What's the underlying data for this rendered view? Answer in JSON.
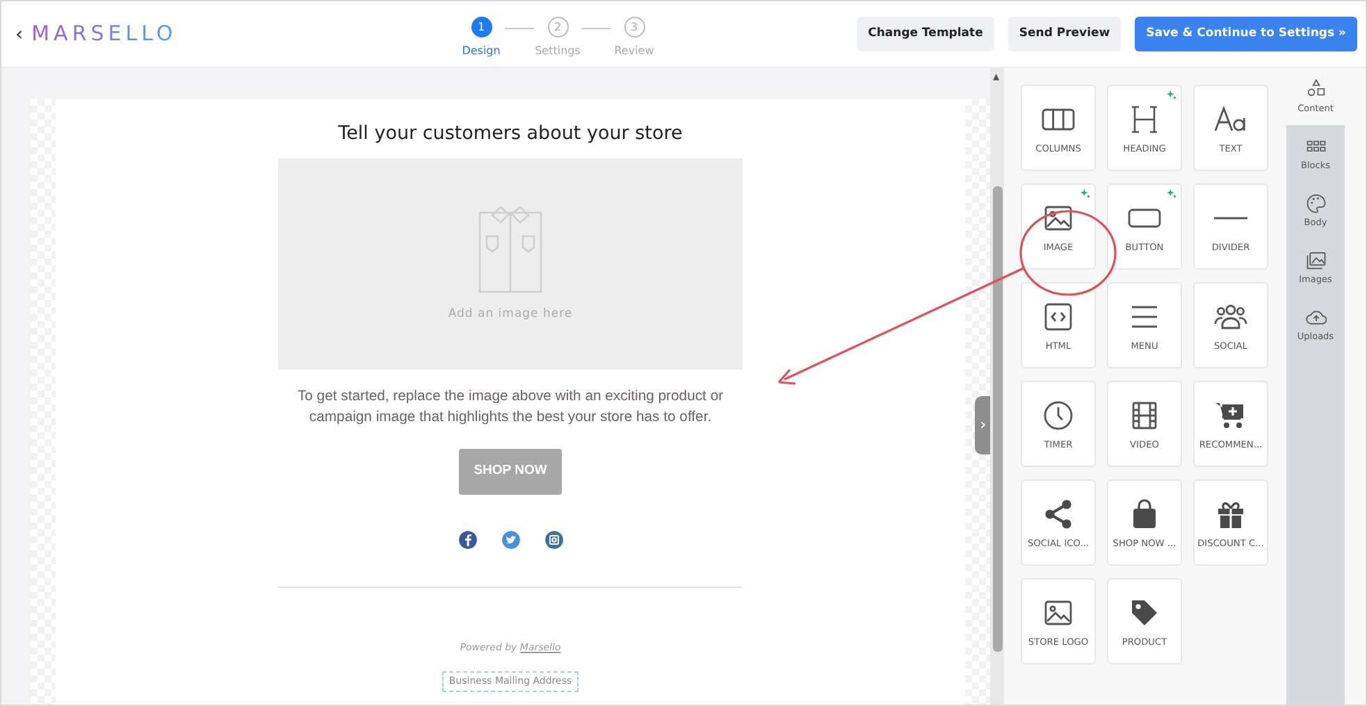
{
  "header": {
    "back": "‹",
    "logo": "MARSELLO",
    "steps": [
      {
        "number": "1",
        "label": "Design",
        "selected": true
      },
      {
        "number": "2",
        "label": "Settings",
        "selected": false
      },
      {
        "number": "3",
        "label": "Review",
        "selected": false
      }
    ],
    "buttons": [
      {
        "label": "Change Template",
        "kind": "secondary"
      },
      {
        "label": "Send Preview",
        "kind": "secondary"
      },
      {
        "label": "Save & Continue to Settings »",
        "kind": "primary"
      }
    ]
  },
  "email": {
    "heading": "Tell your customers about your store",
    "image_placeholder": "Add an image here",
    "paragraph": "To get started, replace the image above with an exciting product or campaign image that highlights the best your store has to offer.",
    "button": "SHOP NOW",
    "social": [
      {
        "color": "#3b5998"
      },
      {
        "color": "#4a90d9"
      },
      {
        "color": "#3f729b"
      }
    ],
    "powered_by": "Powered by",
    "powered_link": "Marsello",
    "address": "Business Mailing Address"
  },
  "handle": "›",
  "scroll_up": "▲",
  "tools": [
    {
      "label": "COLUMNS",
      "new": false
    },
    {
      "label": "HEADING",
      "new": true
    },
    {
      "label": "TEXT",
      "new": false
    },
    {
      "label": "IMAGE",
      "new": true
    },
    {
      "label": "BUTTON",
      "new": true
    },
    {
      "label": "DIVIDER",
      "new": false
    },
    {
      "label": "HTML",
      "new": false
    },
    {
      "label": "MENU",
      "new": false
    },
    {
      "label": "SOCIAL",
      "new": false
    },
    {
      "label": "TIMER",
      "new": false
    },
    {
      "label": "VIDEO",
      "new": false
    },
    {
      "label": "RECOMMEN...",
      "new": false
    },
    {
      "label": "SOCIAL ICO...",
      "new": false
    },
    {
      "label": "SHOP NOW ...",
      "new": false
    },
    {
      "label": "DISCOUNT C...",
      "new": false
    },
    {
      "label": "STORE LOGO",
      "new": false
    },
    {
      "label": "PRODUCT",
      "new": false
    }
  ],
  "rail": [
    {
      "label": "Content",
      "selected": true
    },
    {
      "label": "Blocks",
      "selected": false
    },
    {
      "label": "Body",
      "selected": false
    },
    {
      "label": "Images",
      "selected": false
    },
    {
      "label": "Uploads",
      "selected": false
    }
  ]
}
